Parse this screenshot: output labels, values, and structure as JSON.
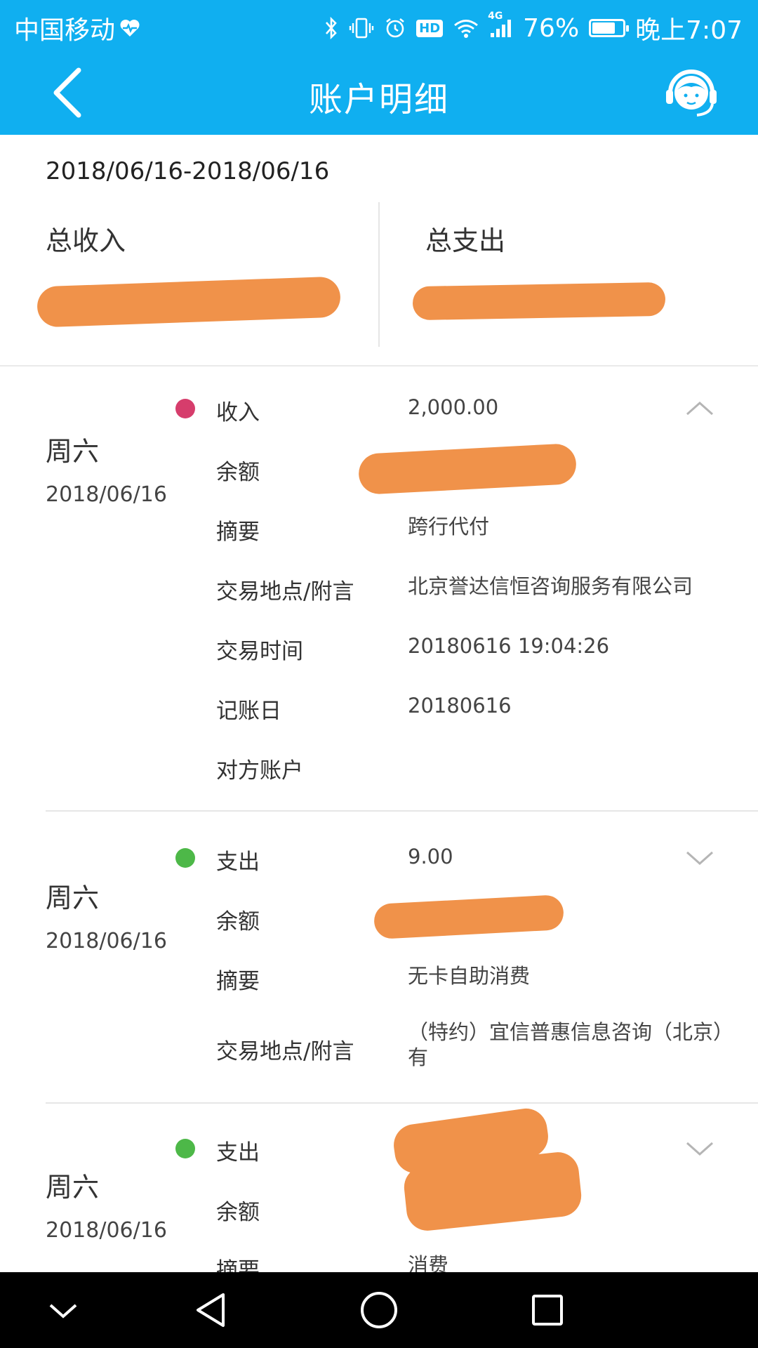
{
  "statusbar": {
    "carrier": "中国移动",
    "battery_percent": "76%",
    "battery_level": 0.76,
    "network": "4G",
    "hd": "HD",
    "time": "晚上7:07"
  },
  "header": {
    "title": "账户明细"
  },
  "summary": {
    "date_range": "2018/06/16-2018/06/16",
    "income_label": "总收入",
    "expense_label": "总支出"
  },
  "transactions": [
    {
      "weekday": "周六",
      "date": "2018/06/16",
      "type": "收入",
      "amount": "2,000.00",
      "expanded": true,
      "fields": {
        "balance_label": "余额",
        "summary_label": "摘要",
        "summary_value": "跨行代付",
        "place_label": "交易地点/附言",
        "place_value": "北京誉达信恒咨询服务有限公司",
        "time_label": "交易时间",
        "time_value": "20180616 19:04:26",
        "post_label": "记账日",
        "post_value": "20180616",
        "counterparty_label": "对方账户"
      }
    },
    {
      "weekday": "周六",
      "date": "2018/06/16",
      "type": "支出",
      "amount": "9.00",
      "expanded": false,
      "fields": {
        "balance_label": "余额",
        "summary_label": "摘要",
        "summary_value": "无卡自助消费",
        "place_label": "交易地点/附言",
        "place_value": "（特约）宜信普惠信息咨询（北京）有"
      }
    },
    {
      "weekday": "周六",
      "date": "2018/06/16",
      "type": "支出",
      "expanded": false,
      "fields": {
        "balance_label": "余额",
        "summary_label": "摘要",
        "summary_value": "消费"
      }
    }
  ],
  "colors": {
    "header_bg": "#10AFF0",
    "income": "#D63D6C",
    "expense": "#4DB848",
    "redaction": "#F0924A"
  },
  "icons": {
    "back": "chevron-left-icon",
    "service": "customer-service-icon",
    "expand": "chevron-up-icon",
    "collapse": "chevron-down-icon"
  }
}
